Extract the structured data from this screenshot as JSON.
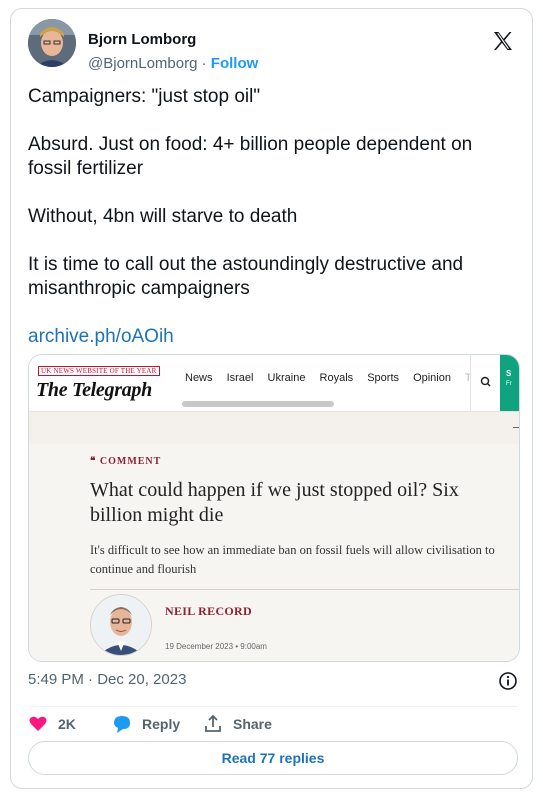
{
  "author": {
    "name": "Bjorn Lomborg",
    "handle": "@BjornLomborg",
    "separator": "·",
    "follow_label": "Follow"
  },
  "tweet": {
    "paragraphs": [
      "Campaigners: \"just stop oil\"",
      "Absurd. Just on food: 4+ billion people dependent on fossil fertilizer",
      "Without, 4bn will starve to death",
      "It is time to call out the astoundingly destructive and misanthropic campaigners"
    ],
    "link": "archive.ph/oAOih"
  },
  "card": {
    "kicker": "UK NEWS WEBSITE OF THE YEAR",
    "logo": "The Telegraph",
    "nav": [
      "News",
      "Israel",
      "Ukraine",
      "Royals",
      "Sports",
      "Opinion",
      "T"
    ],
    "teal_text_1": "S",
    "teal_text_2": "Fr",
    "section": "❝ COMMENT",
    "headline": "What could happen if we just stopped oil? Six billion might die",
    "standfirst": "It's difficult to see how an immediate ban on fossil fuels will allow civilisation to continue and flourish",
    "author": "NEIL RECORD",
    "date": "19 December 2023 • 9:00am"
  },
  "meta": {
    "timestamp": "5:49 PM · Dec 20, 2023"
  },
  "actions": {
    "likes": "2K",
    "reply_label": "Reply",
    "share_label": "Share"
  },
  "read_replies_label": "Read 77 replies",
  "colors": {
    "link": "#1d73b8",
    "like": "#f91880",
    "reply": "#1d9bf0",
    "telegraph_red": "#8b2332",
    "telegraph_teal": "#0fa37f"
  }
}
